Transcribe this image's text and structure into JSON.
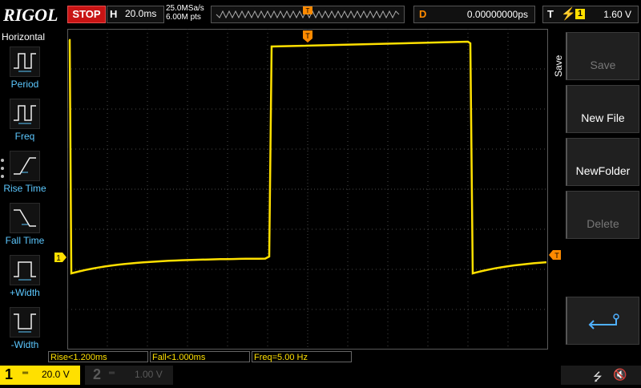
{
  "header": {
    "logo": "RIGOL",
    "run_state": "STOP",
    "timebase_key": "H",
    "timebase": "20.0ms",
    "sample_rate": "25.0MSa/s",
    "memory_depth": "6.00M pts",
    "trigger_pos_marker": "T",
    "delay_key": "D",
    "delay": "0.00000000ps",
    "trigger_key": "T",
    "trigger_source": "1",
    "trigger_level": "1.60 V"
  },
  "left_menu": {
    "title": "Horizontal",
    "items": [
      {
        "label": "Period"
      },
      {
        "label": "Freq"
      },
      {
        "label": "Rise Time"
      },
      {
        "label": "Fall Time"
      },
      {
        "label": "+Width"
      },
      {
        "label": "-Width"
      }
    ]
  },
  "right_menu": {
    "tab": "Save",
    "keys": [
      {
        "label": "Save",
        "enabled": false
      },
      {
        "label": "New File",
        "enabled": true
      },
      {
        "label": "NewFolder",
        "enabled": true
      },
      {
        "label": "Delete",
        "enabled": false
      },
      {
        "label": "",
        "icon": "return-arrow-icon",
        "enabled": true
      }
    ]
  },
  "markers": {
    "channel1_ground": "1",
    "trigger_level": "T",
    "trigger_time": "T"
  },
  "measurements": [
    {
      "label": "Rise<1.200ms"
    },
    {
      "label": "Fall<1.000ms"
    },
    {
      "label": "Freq=5.00 Hz"
    }
  ],
  "channels": [
    {
      "number": "1",
      "coupling": "═",
      "scale": "20.0 V",
      "active": true
    },
    {
      "number": "2",
      "coupling": "═",
      "scale": "1.00 V",
      "active": false
    }
  ],
  "status_icons": [
    "usb-icon",
    "mute-icon"
  ],
  "colors": {
    "ch1": "#ffe000",
    "trigger": "#ff8a00",
    "stop": "#c81414",
    "menu_label": "#5cc8ff"
  }
}
